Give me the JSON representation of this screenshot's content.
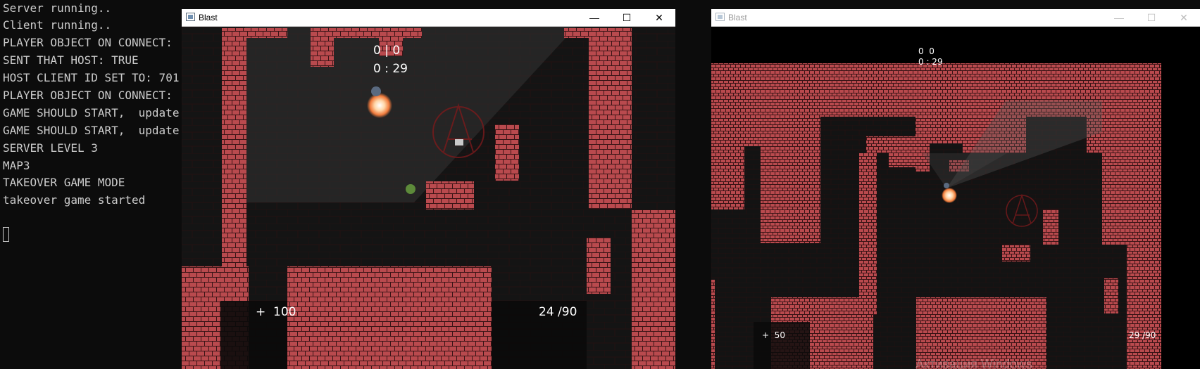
{
  "console": {
    "lines": [
      "Server running..",
      "Client running..",
      "PLAYER OBJECT ON CONNECT:",
      "SENT THAT HOST: TRUE",
      "HOST CLIENT ID SET TO: 701",
      "PLAYER OBJECT ON CONNECT:",
      "GAME SHOULD START,  update",
      "GAME SHOULD START,  update",
      "SERVER LEVEL 3",
      "MAP3",
      "TAKEOVER GAME MODE",
      "takeover game started"
    ]
  },
  "window_host": {
    "title": "Blast",
    "min": "—",
    "max": "☐",
    "close": "✕",
    "score": "0 | 0",
    "timer": "0 : 29",
    "health": "+  100",
    "ammo": "24 /90"
  },
  "window_client": {
    "title": "Blast",
    "min": "—",
    "max": "☐",
    "close": "✕",
    "score": "0  0",
    "timer": "0 : 29",
    "health": "+  50",
    "ammo": "29 /90",
    "watermark": "Активация Windows"
  },
  "colors": {
    "brick": "#b94a4e",
    "mortar": "#3a1416",
    "floor": "#161616",
    "console_bg": "#0c0c0c",
    "console_text": "#cccccc"
  }
}
